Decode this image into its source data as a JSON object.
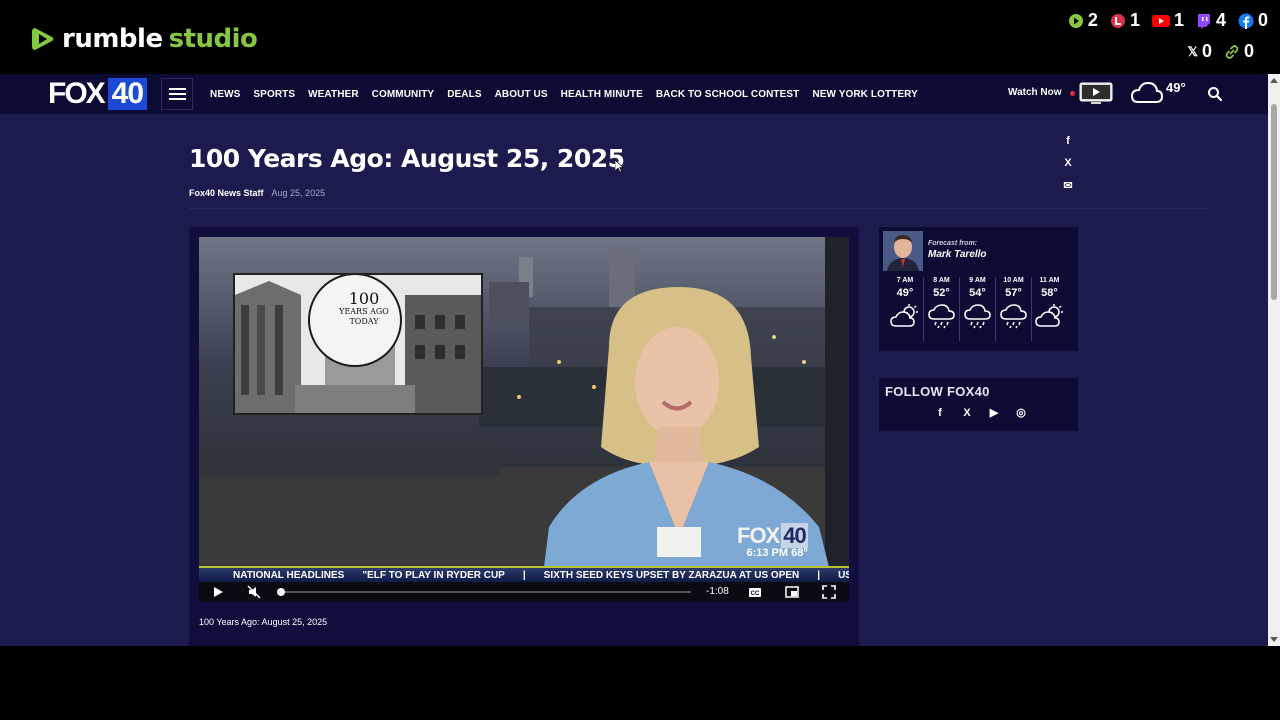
{
  "rumble": {
    "brand": "rumble",
    "suffix": "studio",
    "stats_row1": [
      {
        "platform": "rumble",
        "count": "2",
        "color": "#85c742"
      },
      {
        "platform": "locals",
        "count": "1",
        "color": "#d7334a"
      },
      {
        "platform": "youtube",
        "count": "1",
        "color": "#ff0000"
      },
      {
        "platform": "twitch",
        "count": "4",
        "color": "#9146ff"
      },
      {
        "platform": "facebook",
        "count": "0",
        "color": "#1877f2"
      }
    ],
    "stats_row2": [
      {
        "platform": "x",
        "count": "0",
        "color": "#ffffff"
      },
      {
        "platform": "link",
        "count": "0",
        "color": "#85c742"
      }
    ]
  },
  "site": {
    "logo_fox": "FOX",
    "logo_number": "40",
    "nav": [
      "NEWS",
      "SPORTS",
      "WEATHER",
      "COMMUNITY",
      "DEALS",
      "ABOUT US",
      "HEALTH MINUTE",
      "BACK TO SCHOOL CONTEST",
      "NEW YORK LOTTERY"
    ],
    "watch_now": "Watch Now",
    "current_temp": "49°"
  },
  "article": {
    "title": "100 Years Ago: August 25, 2025",
    "author": "Fox40 News Staff",
    "date": "Aug 25, 2025",
    "share": [
      "f",
      "X",
      "✉"
    ]
  },
  "video": {
    "inset_number": "100",
    "inset_line1": "YEARS AGO",
    "inset_line2": "TODAY",
    "bug_fox": "FOX",
    "bug_num": "40",
    "bug_time": "6:13 PM  68°",
    "ticker": [
      "NATIONAL HEADLINES",
      "\"ELF TO PLAY IN RYDER CUP",
      "|",
      "SIXTH SEED KEYS UPSET BY ZARAZUA AT US OPEN",
      "|",
      "US BACK"
    ],
    "remaining": "-1:08",
    "progress": 0.0,
    "caption": "100 Years Ago: August 25, 2025"
  },
  "forecast": {
    "label": "Forecast from:",
    "meteorologist": "Mark Tarello",
    "hours": [
      {
        "time": "7 AM",
        "temp": "49°",
        "icon": "partly-cloudy-sun"
      },
      {
        "time": "8 AM",
        "temp": "52°",
        "icon": "rain-cloud"
      },
      {
        "time": "9 AM",
        "temp": "54°",
        "icon": "rain-cloud"
      },
      {
        "time": "10 AM",
        "temp": "57°",
        "icon": "rain-cloud"
      },
      {
        "time": "11 AM",
        "temp": "58°",
        "icon": "partly-cloudy-sun"
      }
    ]
  },
  "follow": {
    "title": "FOLLOW FOX40",
    "icons": [
      "f",
      "X",
      "▶",
      "◎"
    ]
  }
}
